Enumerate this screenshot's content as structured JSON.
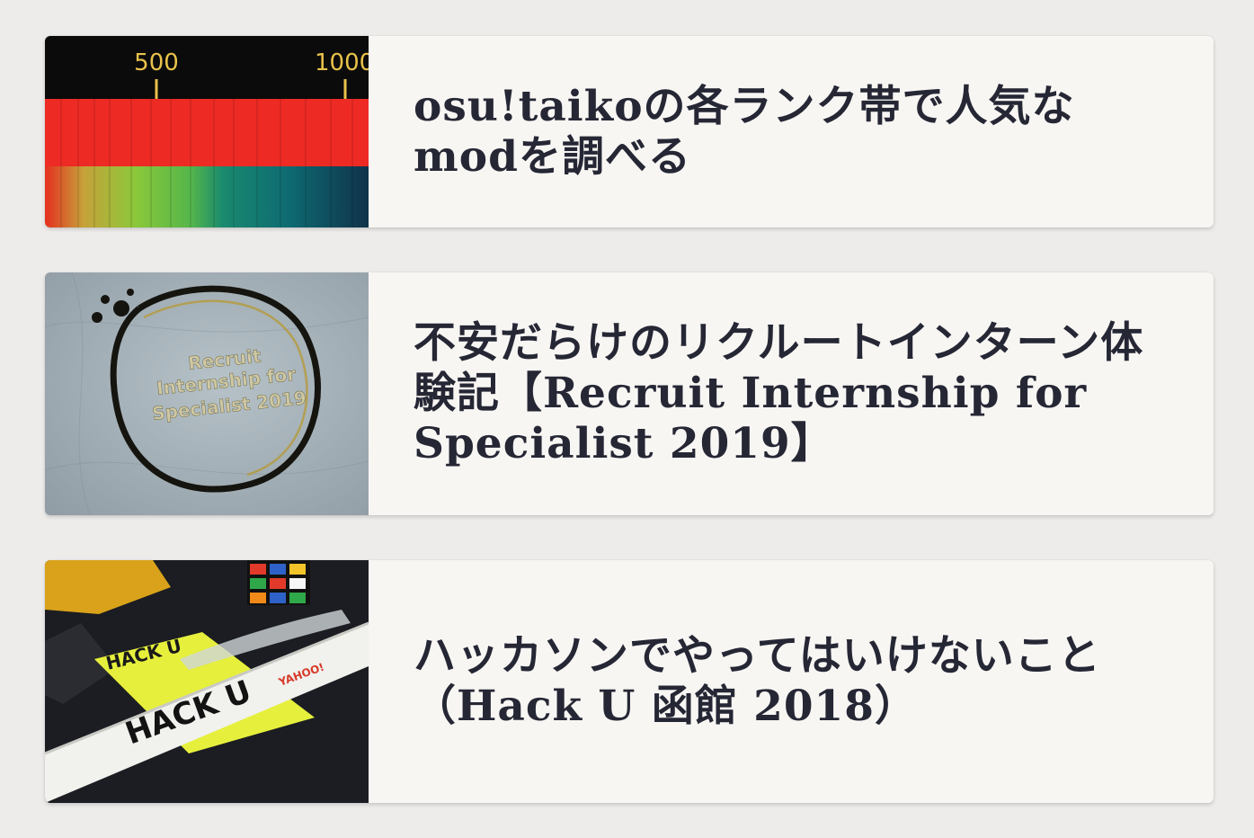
{
  "posts": [
    {
      "title": "osu!taikoの各ランク帯で人気なmodを調べる",
      "thumbnail": {
        "description_icon": "chart-thumbnail",
        "tick_labels": [
          "500",
          "1000"
        ]
      }
    },
    {
      "title": "不安だらけのリクルートインターン体験記【Recruit Internship for Specialist 2019】",
      "thumbnail": {
        "description_icon": "bag-print-thumbnail",
        "print_lines": [
          "Recruit",
          "Internship for",
          "Specialist 2019"
        ]
      }
    },
    {
      "title": "ハッカソンでやってはいけないこと（Hack U 函館 2018）",
      "thumbnail": {
        "description_icon": "hack-u-pen-thumbnail",
        "pen_text": "HACK U",
        "card_text": "HACK U",
        "brand_text": "YAHOO!"
      }
    }
  ],
  "colors": {
    "background": "#edecea",
    "card": "#f8f6f3",
    "title": "#262735"
  }
}
